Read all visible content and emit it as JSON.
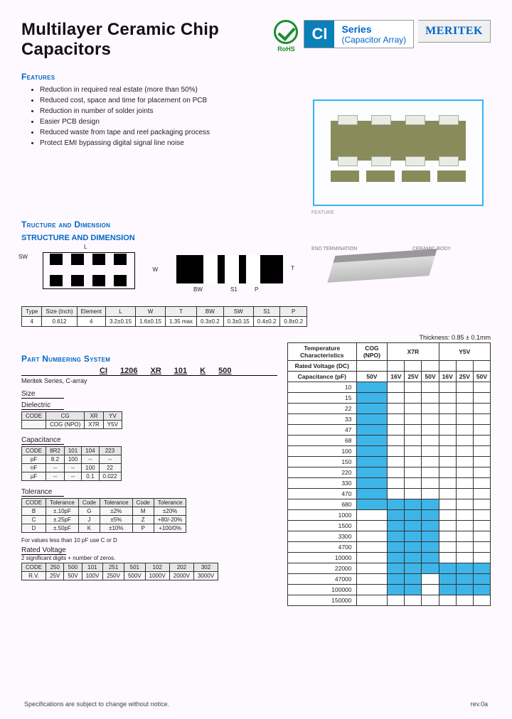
{
  "header": {
    "title": "Multilayer Ceramic Chip Capacitors",
    "rohs_label": "RoHS",
    "series_code": "CI",
    "series_label": "Series",
    "series_sub": "(Capacitor Array)",
    "brand": "MERITEK"
  },
  "features": {
    "heading": "Features",
    "items": [
      "Reduction in required real estate (more than 50%)",
      "Reduced cost, space and time for placement on PCB",
      "Reduction in number of solder joints",
      "Easier PCB design",
      "Reduced waste from tape and reel packaging process",
      "Protect EMI bypassing digital signal line noise"
    ]
  },
  "feature_caption": "FEATURE",
  "structure": {
    "heading": "Tructure and Dimension",
    "sub": "STRUCTURE AND DIMENSION",
    "dim_labels": {
      "L": "L",
      "W": "W",
      "SW": "SW",
      "T": "T",
      "BW": "BW",
      "S1": "S1",
      "P": "P"
    },
    "perspective_labels": {
      "term": "END TERMINATION",
      "body": "CERAMIC BODY"
    }
  },
  "dim_table": {
    "headers": [
      "Type",
      "Size (Inch)",
      "Element",
      "L",
      "W",
      "T",
      "BW",
      "SW",
      "S1",
      "P"
    ],
    "row": [
      "4",
      "0.612",
      "4",
      "3.2±0.15",
      "1.6±0.15",
      "1.35 max",
      "0.3±0.2",
      "0.3±0.15",
      "0.4±0.2",
      "0.8±0.2"
    ]
  },
  "pns": {
    "heading": "Part Numbering System",
    "example_prefix": "Meritek Series, C-array",
    "codes": [
      "CI",
      "1206",
      "XR",
      "101",
      "K",
      "500"
    ],
    "labels": {
      "size": "Size",
      "dielectric": "Dielectric",
      "capacitance": "Capacitance",
      "tolerance": "Tolerance",
      "rated_voltage": "Rated Voltage"
    },
    "dielectric": {
      "headers": [
        "CODE",
        "CG",
        "XR",
        "YV"
      ],
      "row": [
        "",
        "COG (NPO)",
        "X7R",
        "Y5V"
      ]
    },
    "capacitance": {
      "headers": [
        "CODE",
        "8R2",
        "101",
        "104",
        "223"
      ],
      "rows": [
        [
          "pF",
          "8.2",
          "100",
          "--",
          "--"
        ],
        [
          "nF",
          "--",
          "--",
          "100",
          "22"
        ],
        [
          "µF",
          "--",
          "--",
          "0.1",
          "0.022"
        ]
      ]
    },
    "tolerance": {
      "headers": [
        "CODE",
        "Tolerance",
        "Code",
        "Tolerance",
        "Code",
        "Tolerance"
      ],
      "rows": [
        [
          "B",
          "±.10pF",
          "G",
          "±2%",
          "M",
          "±20%"
        ],
        [
          "C",
          "±.25pF",
          "J",
          "±5%",
          "Z",
          "+80/-20%"
        ],
        [
          "D",
          "±.50pF",
          "K",
          "±10%",
          "P",
          "+100/0%"
        ]
      ],
      "note": "For values less than 10 pF use C or D"
    },
    "voltage": {
      "note": "2 significant digits + number of zeros.",
      "headers": [
        "CODE",
        "250",
        "500",
        "101",
        "251",
        "501",
        "102",
        "202",
        "302"
      ],
      "row": [
        "R.V.",
        "25V",
        "50V",
        "100V",
        "250V",
        "500V",
        "1000V",
        "2000V",
        "3000V"
      ]
    }
  },
  "cap_table": {
    "thickness": "Thickness: 0.85 ± 0.1mm",
    "col_top": [
      "Temperature Characteristics",
      "COG (NPO)",
      "X7R",
      "Y5V"
    ],
    "rated_label": "Rated Voltage (DC)",
    "cap_label": "Capacitance (pF)",
    "voltages": [
      "50V",
      "16V",
      "25V",
      "50V",
      "16V",
      "25V",
      "50V"
    ],
    "rows": [
      {
        "pf": "10",
        "on": [
          0
        ]
      },
      {
        "pf": "15",
        "on": [
          0
        ]
      },
      {
        "pf": "22",
        "on": [
          0
        ]
      },
      {
        "pf": "33",
        "on": [
          0
        ]
      },
      {
        "pf": "47",
        "on": [
          0
        ]
      },
      {
        "pf": "68",
        "on": [
          0
        ]
      },
      {
        "pf": "100",
        "on": [
          0
        ]
      },
      {
        "pf": "150",
        "on": [
          0
        ]
      },
      {
        "pf": "220",
        "on": [
          0
        ]
      },
      {
        "pf": "330",
        "on": [
          0
        ]
      },
      {
        "pf": "470",
        "on": [
          0
        ]
      },
      {
        "pf": "680",
        "on": [
          0,
          1,
          2,
          3
        ]
      },
      {
        "pf": "1000",
        "on": [
          1,
          2,
          3
        ]
      },
      {
        "pf": "1500",
        "on": [
          1,
          2,
          3
        ]
      },
      {
        "pf": "3300",
        "on": [
          1,
          2,
          3
        ]
      },
      {
        "pf": "4700",
        "on": [
          1,
          2,
          3
        ]
      },
      {
        "pf": "10000",
        "on": [
          1,
          2,
          3
        ]
      },
      {
        "pf": "22000",
        "on": [
          1,
          2,
          3,
          4,
          5,
          6
        ]
      },
      {
        "pf": "47000",
        "on": [
          1,
          2,
          4,
          5,
          6
        ]
      },
      {
        "pf": "100000",
        "on": [
          1,
          2,
          4,
          5,
          6
        ]
      },
      {
        "pf": "150000",
        "on": []
      }
    ]
  },
  "footer": {
    "note": "Specifications are subject to change without notice.",
    "rev": "rev.0a"
  }
}
